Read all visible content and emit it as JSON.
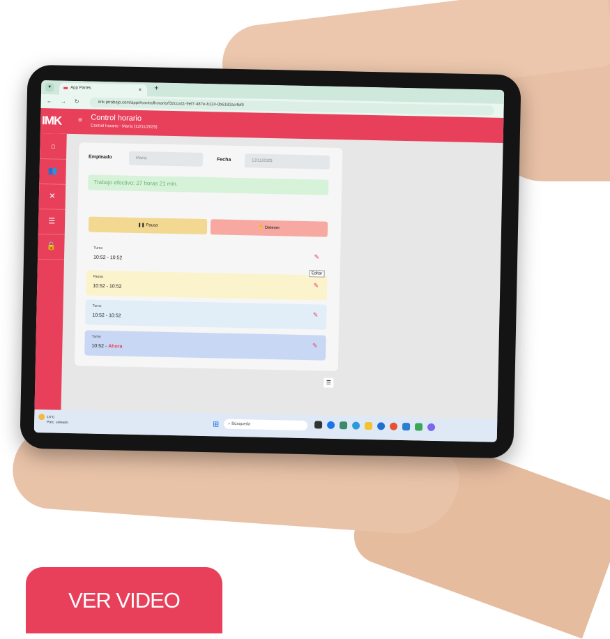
{
  "browser": {
    "tab_title": "App Partes",
    "tab_close": "×",
    "new_tab": "+",
    "url": "imk.ptrabajo.com/app/#controlhorario/f32cca11-9ef7-487e-b124-0b6182ac4bf9"
  },
  "app": {
    "logo": "IMK",
    "header_title": "Control horario",
    "header_subtitle": "Control horario - María (12/11/2025)"
  },
  "form": {
    "empleado_label": "Empleado",
    "empleado_value": "María",
    "fecha_label": "Fecha",
    "fecha_value": "12/11/2025",
    "alert": "Trabajo efectivo: 27 horas 21 min.",
    "pausa_button": "Pausa",
    "detener_button": "Detener"
  },
  "entries": [
    {
      "type": "Turno",
      "time": "10:52 - 10:52",
      "color": "#f6f6f6"
    },
    {
      "type": "Pausa",
      "time": "10:52 - 10:52",
      "color": "#fbf3cc"
    },
    {
      "type": "Turno",
      "time": "10:52 - 10:52",
      "color": "#e1eef8"
    },
    {
      "type": "Turno",
      "time_start": "10:52 - ",
      "time_end": "Ahora",
      "color": "#c8d8f4"
    }
  ],
  "tooltip": "Editar",
  "taskbar": {
    "temperature": "18°C",
    "weather": "Parc. soleado",
    "search": "Búsqueda"
  },
  "cta": "VER VIDEO",
  "colors": {
    "brand": "#e8405a",
    "success_bg": "#d6f2d9",
    "success_text": "#6ab46f",
    "pause": "#f3d892",
    "stop": "#f6a8a1"
  },
  "icons": {
    "sidebar": [
      "home-icon",
      "users-icon",
      "tools-icon",
      "list-icon",
      "lock-icon"
    ],
    "edit": "edit-icon"
  }
}
